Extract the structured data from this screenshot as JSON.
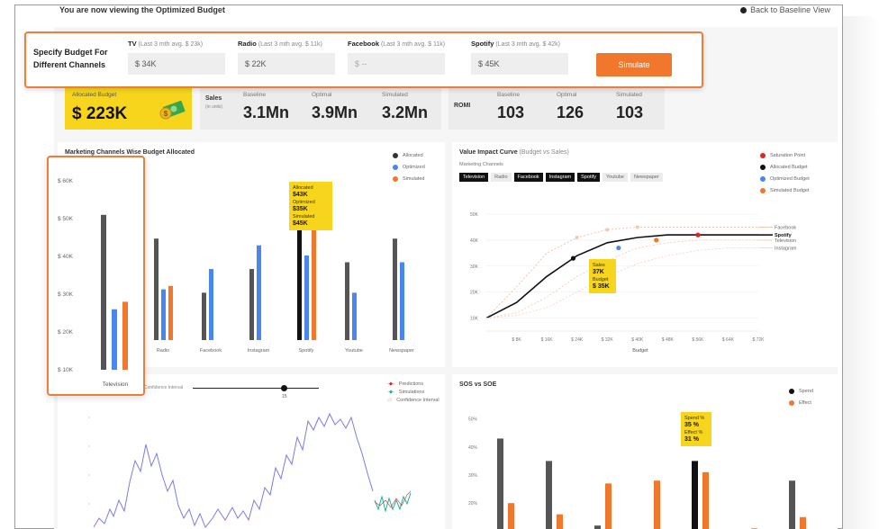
{
  "banner": {
    "viewing_text": "You are now viewing the Optimized Budget",
    "back_label": "Back to Baseline View"
  },
  "budget_popup": {
    "title": "Specify Budget For Different Channels",
    "fields": [
      {
        "channel": "TV",
        "avg": "(Last 3 mth avg. $ 23k)",
        "value": "$ 34K"
      },
      {
        "channel": "Radio",
        "avg": "(Last 3 mth avg. $ 11k)",
        "value": "$ 22K"
      },
      {
        "channel": "Facebook",
        "avg": "(Last 3 mth avg. $ 11k)",
        "value": "$ --"
      },
      {
        "channel": "Spotify",
        "avg": "(Last 3 mth avg. $ 42k)",
        "value": "$ 45K"
      }
    ],
    "simulate_label": "Simulate"
  },
  "kpis": {
    "allocated_label": "Allocated Budget",
    "allocated_value": "$ 223K",
    "sales": {
      "label": "Sales",
      "sublabel": "(in units)",
      "items": [
        {
          "label": "Baseline",
          "value": "3.1Mn"
        },
        {
          "label": "Optimal",
          "value": "3.9Mn"
        },
        {
          "label": "Simulated",
          "value": "3.2Mn"
        }
      ]
    },
    "romi": {
      "label": "ROMI",
      "items": [
        {
          "label": "Baseline",
          "value": "103"
        },
        {
          "label": "Optimal",
          "value": "126"
        },
        {
          "label": "Simulated",
          "value": "103"
        }
      ]
    }
  },
  "channel_budget": {
    "title": "Marketing Channels Wise Budget Allocated",
    "legend": [
      "Allocated",
      "Optimized",
      "Simulated"
    ],
    "tooltip": {
      "allocated_label": "Allocated",
      "allocated": "$43K",
      "optimized_label": "Optimized",
      "optimized": "$35K",
      "simulated_label": "Simulated",
      "simulated": "$45K"
    }
  },
  "value_impact": {
    "title": "Value Impact Curve",
    "title_suffix": "(Budget vs Sales)",
    "subtitle": "Marketing Channels",
    "tabs": [
      "Television",
      "Radio",
      "Facebook",
      "Instagram",
      "Spotify",
      "Youtube",
      "Newspaper"
    ],
    "legend": [
      "Saturation Point",
      "Allocated Budget",
      "Optimized Budget",
      "Simulated Budget"
    ],
    "tooltip": {
      "sales_label": "Sales",
      "sales": "37K",
      "budget_label": "Budget",
      "budget": "$ 35K"
    }
  },
  "forecast": {
    "slider_label": "Confidence Interval",
    "slider_value": "15",
    "legend": [
      "Predictions",
      "Simulations",
      "Confidence Interval"
    ]
  },
  "sos_soe": {
    "title": "SOS vs SOE",
    "legend": [
      "Spend",
      "Effect"
    ],
    "tooltip": {
      "spend_label": "Spend %",
      "spend": "35 %",
      "effect_label": "Effect %",
      "effect": "31 %"
    }
  },
  "colors": {
    "allocated": "#555555",
    "optimized": "#4a86f0",
    "simulated": "#f0772b",
    "highlight": "#f7d51d",
    "accent_border": "#ee7d3a",
    "saturation": "#e02424"
  },
  "chart_data": [
    {
      "type": "bar",
      "title": "Marketing Channels Wise Budget Allocated",
      "categories": [
        "Television",
        "Radio",
        "Facebook",
        "Instagram",
        "Spotify",
        "Youtube",
        "Newspaper"
      ],
      "series": [
        {
          "name": "Allocated",
          "values": [
            51,
            40,
            24,
            31,
            43,
            33,
            40
          ]
        },
        {
          "name": "Optimized",
          "values": [
            26,
            25,
            31,
            38,
            35,
            24,
            33
          ]
        },
        {
          "name": "Simulated",
          "values": [
            28,
            26,
            null,
            null,
            45,
            null,
            null
          ]
        }
      ],
      "ylabel": "",
      "yticks": [
        "$ 60K",
        "$ 50K",
        "$ 40K",
        "$ 30K",
        "$ 20K",
        "$ 10K"
      ],
      "ylim": [
        10,
        60
      ],
      "legend_position": "top-right"
    },
    {
      "type": "line",
      "title": "Value Impact Curve (Budget vs Sales)",
      "xlabel": "Budget",
      "xticks": [
        "$ 8K",
        "$ 16K",
        "$ 24K",
        "$ 32K",
        "$ 40K",
        "$ 48K",
        "$ 56K",
        "$ 64K",
        "$ 72K"
      ],
      "yticks": [
        "50K",
        "40K",
        "30K",
        "20K",
        "10K"
      ],
      "series": [
        {
          "name": "Facebook",
          "x": [
            0,
            8,
            16,
            24,
            32,
            40,
            48,
            56,
            64,
            72
          ],
          "y": [
            10,
            22,
            35,
            41,
            44,
            45,
            45,
            45,
            45,
            45
          ]
        },
        {
          "name": "Spotify",
          "x": [
            0,
            8,
            16,
            24,
            32,
            40,
            48,
            56,
            64,
            72
          ],
          "y": [
            10,
            16,
            26,
            34,
            39,
            41,
            42,
            42,
            42,
            42
          ]
        },
        {
          "name": "Television",
          "x": [
            0,
            8,
            16,
            24,
            32,
            40,
            48,
            56,
            64,
            72
          ],
          "y": [
            10,
            12,
            18,
            26,
            32,
            37,
            39,
            40,
            40,
            40
          ]
        },
        {
          "name": "Instagram",
          "x": [
            0,
            8,
            16,
            24,
            32,
            40,
            48,
            56,
            64,
            72
          ],
          "y": [
            10,
            11,
            14,
            20,
            26,
            31,
            34,
            36,
            37,
            37
          ]
        }
      ],
      "points": [
        {
          "name": "Allocated Budget",
          "x": 23,
          "y": 33
        },
        {
          "name": "Optimized Budget",
          "x": 35,
          "y": 37
        },
        {
          "name": "Simulated Budget",
          "x": 45,
          "y": 40
        },
        {
          "name": "Saturation Point",
          "x": 56,
          "y": 42
        }
      ],
      "legend_position": "top-right"
    },
    {
      "type": "bar",
      "title": "SOS vs SOE",
      "yticks": [
        "50%",
        "40%",
        "30%",
        "20%",
        "10%"
      ],
      "ylim": [
        5,
        55
      ],
      "series": [
        {
          "name": "Spend",
          "values": [
            43,
            35,
            12,
            9,
            35,
            10,
            28
          ]
        },
        {
          "name": "Effect",
          "values": [
            20,
            16,
            27,
            28,
            31,
            11,
            15
          ]
        }
      ],
      "legend_position": "top-right"
    }
  ]
}
